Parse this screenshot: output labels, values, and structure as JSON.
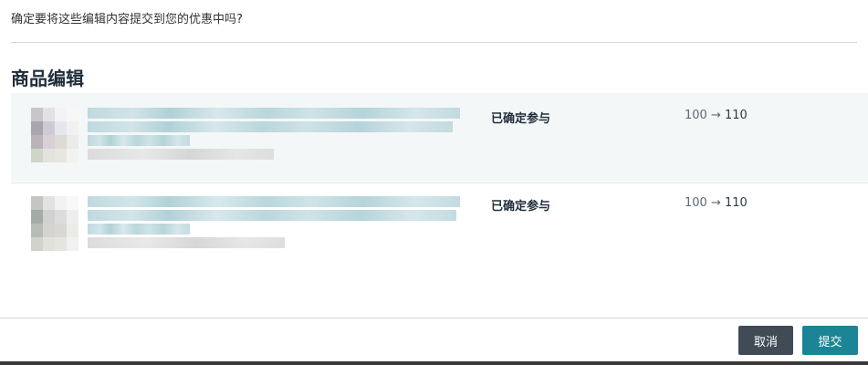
{
  "dialog": {
    "question": "确定要将这些编辑内容提交到您的优惠中吗?",
    "section_title": "商品编辑",
    "items": [
      {
        "status": "已确定参与",
        "old_value": "100",
        "arrow": "→",
        "new_value": "110"
      },
      {
        "status": "已确定参与",
        "old_value": "100",
        "arrow": "→",
        "new_value": "110"
      }
    ],
    "cancel_label": "取消",
    "submit_label": "提交"
  },
  "colors": {
    "title": "#1f2d3a",
    "row_shade": "#f4f7f8",
    "cancel_button": "#414b56",
    "submit_button": "#1b8495"
  }
}
